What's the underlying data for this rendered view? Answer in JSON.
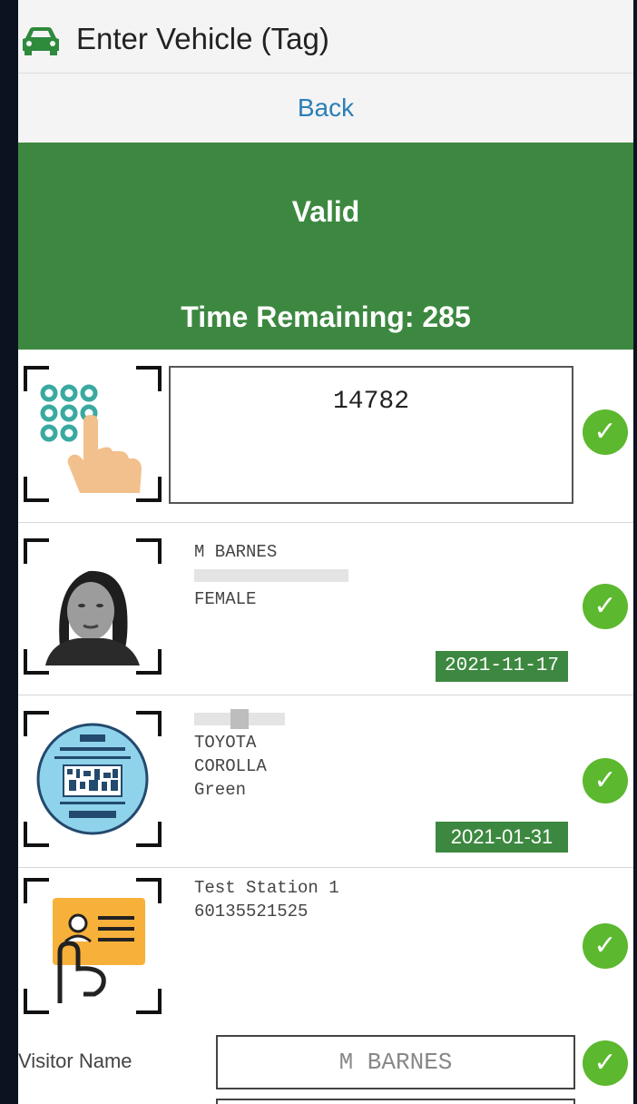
{
  "header": {
    "title": "Enter Vehicle (Tag)",
    "icon": "car-icon"
  },
  "back_button": {
    "label": "Back"
  },
  "status": {
    "state": "Valid",
    "time_remaining": "Time Remaining: 285",
    "color": "#3d8840"
  },
  "code_entry": {
    "value": "14782",
    "icon": "keypad-hand-icon"
  },
  "person": {
    "name": "M BARNES",
    "gender": "FEMALE",
    "date": "2021-11-17",
    "icon": "face-photo"
  },
  "vehicle": {
    "make": "TOYOTA",
    "model": "COROLLA",
    "color": "Green",
    "date": "2021-01-31",
    "icon": "license-disc-icon"
  },
  "station": {
    "name": "Test Station 1",
    "number": "60135521525",
    "icon": "id-card-hand-icon"
  },
  "visitor": {
    "label": "Visitor Name",
    "value": "M BARNES"
  },
  "check_color": "#5cb82e"
}
